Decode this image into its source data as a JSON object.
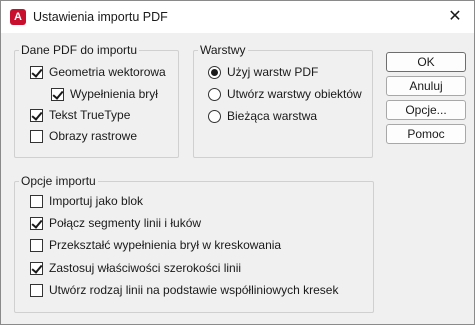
{
  "window": {
    "title": "Ustawienia importu PDF",
    "app_icon_letter": "A",
    "close_glyph": "✕"
  },
  "pdf_data_group": {
    "legend": "Dane PDF do importu",
    "items": [
      {
        "label": "Geometria wektorowa",
        "checked": true
      },
      {
        "label": "Wypełnienia brył",
        "checked": true
      },
      {
        "label": "Tekst TrueType",
        "checked": true
      },
      {
        "label": "Obrazy rastrowe",
        "checked": false
      }
    ]
  },
  "layers_group": {
    "legend": "Warstwy",
    "options": [
      {
        "label": "Użyj warstw PDF",
        "selected": true
      },
      {
        "label": "Utwórz warstwy obiektów",
        "selected": false
      },
      {
        "label": "Bieżąca warstwa",
        "selected": false
      }
    ]
  },
  "import_options_group": {
    "legend": "Opcje importu",
    "items": [
      {
        "label": "Importuj jako blok",
        "checked": false
      },
      {
        "label": "Połącz segmenty linii i łuków",
        "checked": true
      },
      {
        "label": "Przekształć wypełnienia brył w kreskowania",
        "checked": false
      },
      {
        "label": "Zastosuj właściwości szerokości linii",
        "checked": true
      },
      {
        "label": "Utwórz rodzaj linii na podstawie współliniowych kresek",
        "checked": false
      }
    ]
  },
  "buttons": {
    "ok": "OK",
    "cancel": "Anuluj",
    "options": "Opcje...",
    "help": "Pomoc"
  }
}
